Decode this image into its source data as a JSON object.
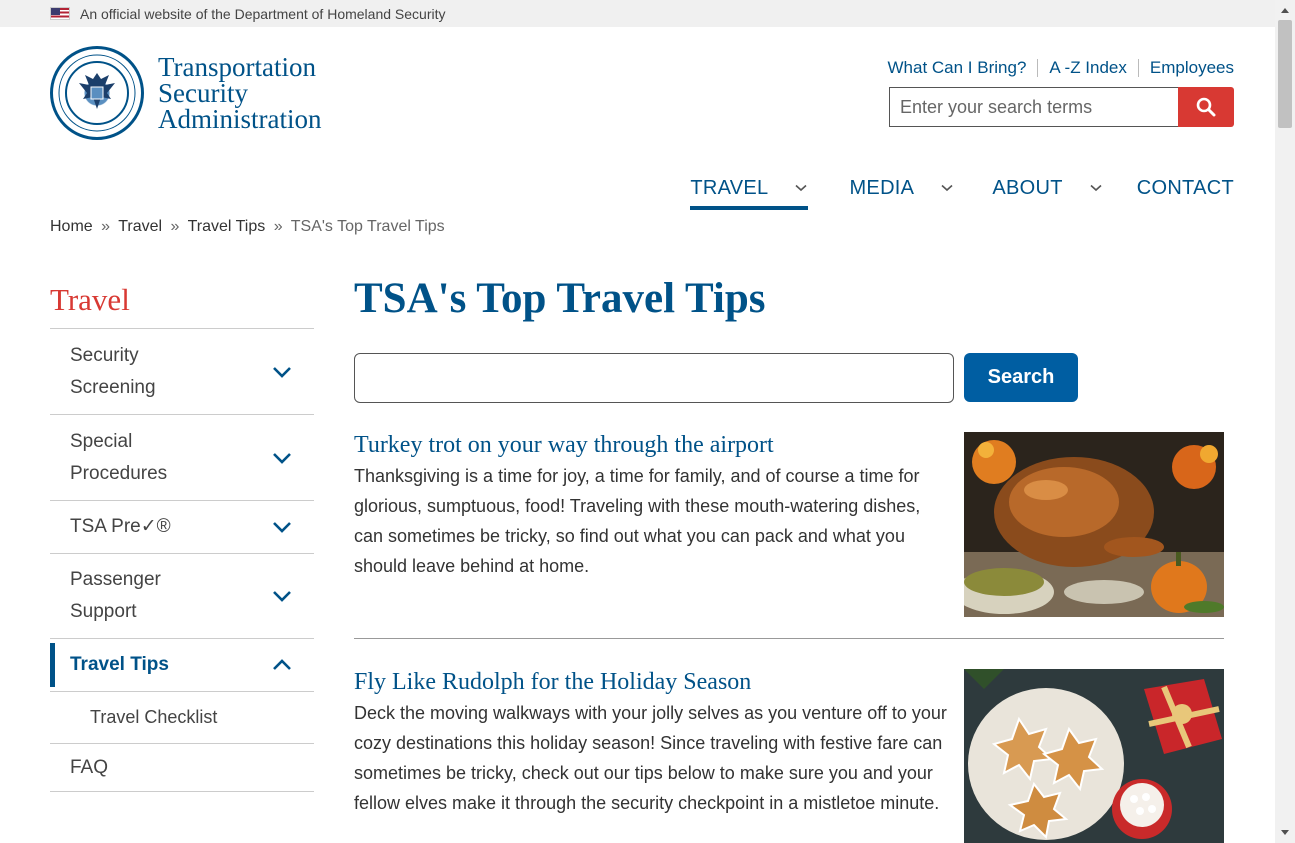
{
  "gov_banner": {
    "text": "An official website of the Department of Homeland Security",
    "flag_icon": "us-flag-icon"
  },
  "logo": {
    "line1": "Transportation",
    "line2": "Security",
    "line3": "Administration",
    "seal_icon": "dhs-seal-icon"
  },
  "utility_links": [
    "What Can I Bring?",
    "A -Z Index",
    "Employees"
  ],
  "header_search": {
    "placeholder": "Enter your search terms",
    "button_icon": "search-icon"
  },
  "main_nav": [
    {
      "label": "TRAVEL",
      "has_dropdown": true,
      "active": true
    },
    {
      "label": "MEDIA",
      "has_dropdown": true,
      "active": false
    },
    {
      "label": "ABOUT",
      "has_dropdown": true,
      "active": false
    },
    {
      "label": "CONTACT",
      "has_dropdown": false,
      "active": false
    }
  ],
  "breadcrumb": {
    "items": [
      "Home",
      "Travel",
      "Travel Tips"
    ],
    "current": "TSA's Top Travel Tips",
    "separator": "»"
  },
  "sidebar": {
    "title": "Travel",
    "items": [
      {
        "label_line1": "Security",
        "label_line2": "Screening",
        "expanded": false
      },
      {
        "label_line1": "Special",
        "label_line2": "Procedures",
        "expanded": false
      },
      {
        "label_line1": "TSA Pre✓®",
        "label_line2": "",
        "expanded": false
      },
      {
        "label_line1": "Passenger",
        "label_line2": "Support",
        "expanded": false
      },
      {
        "label_line1": "Travel Tips",
        "label_line2": "",
        "expanded": true
      }
    ],
    "sub_item": "Travel Checklist",
    "faq": "FAQ"
  },
  "main": {
    "title": "TSA's Top Travel Tips",
    "search_button": "Search",
    "teasers": [
      {
        "title": "Turkey trot on your way through the airport",
        "body": "Thanksgiving is a time for joy, a time for family, and of course a time for glorious, sumptuous, food! Traveling with these mouth-watering dishes, can sometimes be tricky, so find out what you can pack and what you should leave behind at home.",
        "image": "roast-turkey-image"
      },
      {
        "title": "Fly Like Rudolph for the Holiday Season",
        "body": "Deck the moving walkways with your jolly selves as you venture off to your cozy destinations this holiday season! Since traveling with festive fare can sometimes be tricky, check out our tips below to make sure you and your fellow elves make it through the security checkpoint in a mistletoe minute.",
        "image": "holiday-cookies-image"
      }
    ]
  },
  "colors": {
    "brand_blue": "#005288",
    "accent_red": "#d83933",
    "button_blue": "#005ea2"
  }
}
